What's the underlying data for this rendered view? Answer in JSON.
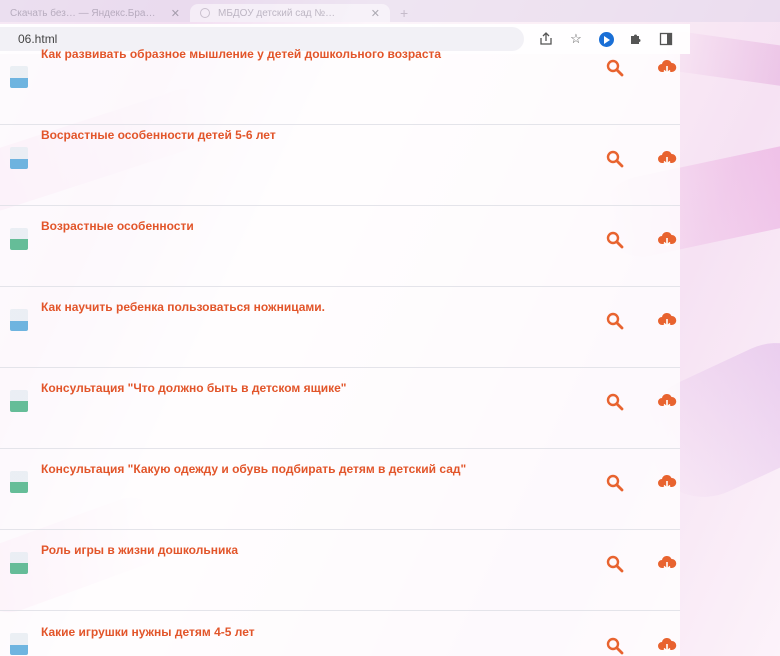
{
  "browser": {
    "tabs": [
      {
        "title": "Скачать без… — Яндекс.Бра…",
        "state": "inactive"
      },
      {
        "title": "МБДОУ детский сад №…",
        "state": "active"
      }
    ],
    "url": "06.html"
  },
  "documents": [
    {
      "title": "Как развивать образное мышление у детей дошкольного возраста",
      "icon_color": "blue"
    },
    {
      "title": "Восрастные особенности детей 5-6 лет",
      "icon_color": "blue"
    },
    {
      "title": "Возрастные особенности",
      "icon_color": "green"
    },
    {
      "title": "Как научить ребенка пользоваться ножницами.",
      "icon_color": "blue"
    },
    {
      "title": "Консультация \"Что должно быть в детском ящике\"",
      "icon_color": "green"
    },
    {
      "title": "Консультация \"Какую одежду и обувь подбирать детям в детский сад\"",
      "icon_color": "green"
    },
    {
      "title": "Роль игры в жизни дошкольника",
      "icon_color": "green"
    },
    {
      "title": "Какие игрушки нужны детям 4-5 лет",
      "icon_color": "blue"
    }
  ],
  "colors": {
    "title": "#e2552a",
    "action_icon": "#e8632f",
    "background_accent": "#e07ccf"
  },
  "icons": {
    "view": "search-icon",
    "download": "cloud-download-icon",
    "document": "document-icon"
  }
}
